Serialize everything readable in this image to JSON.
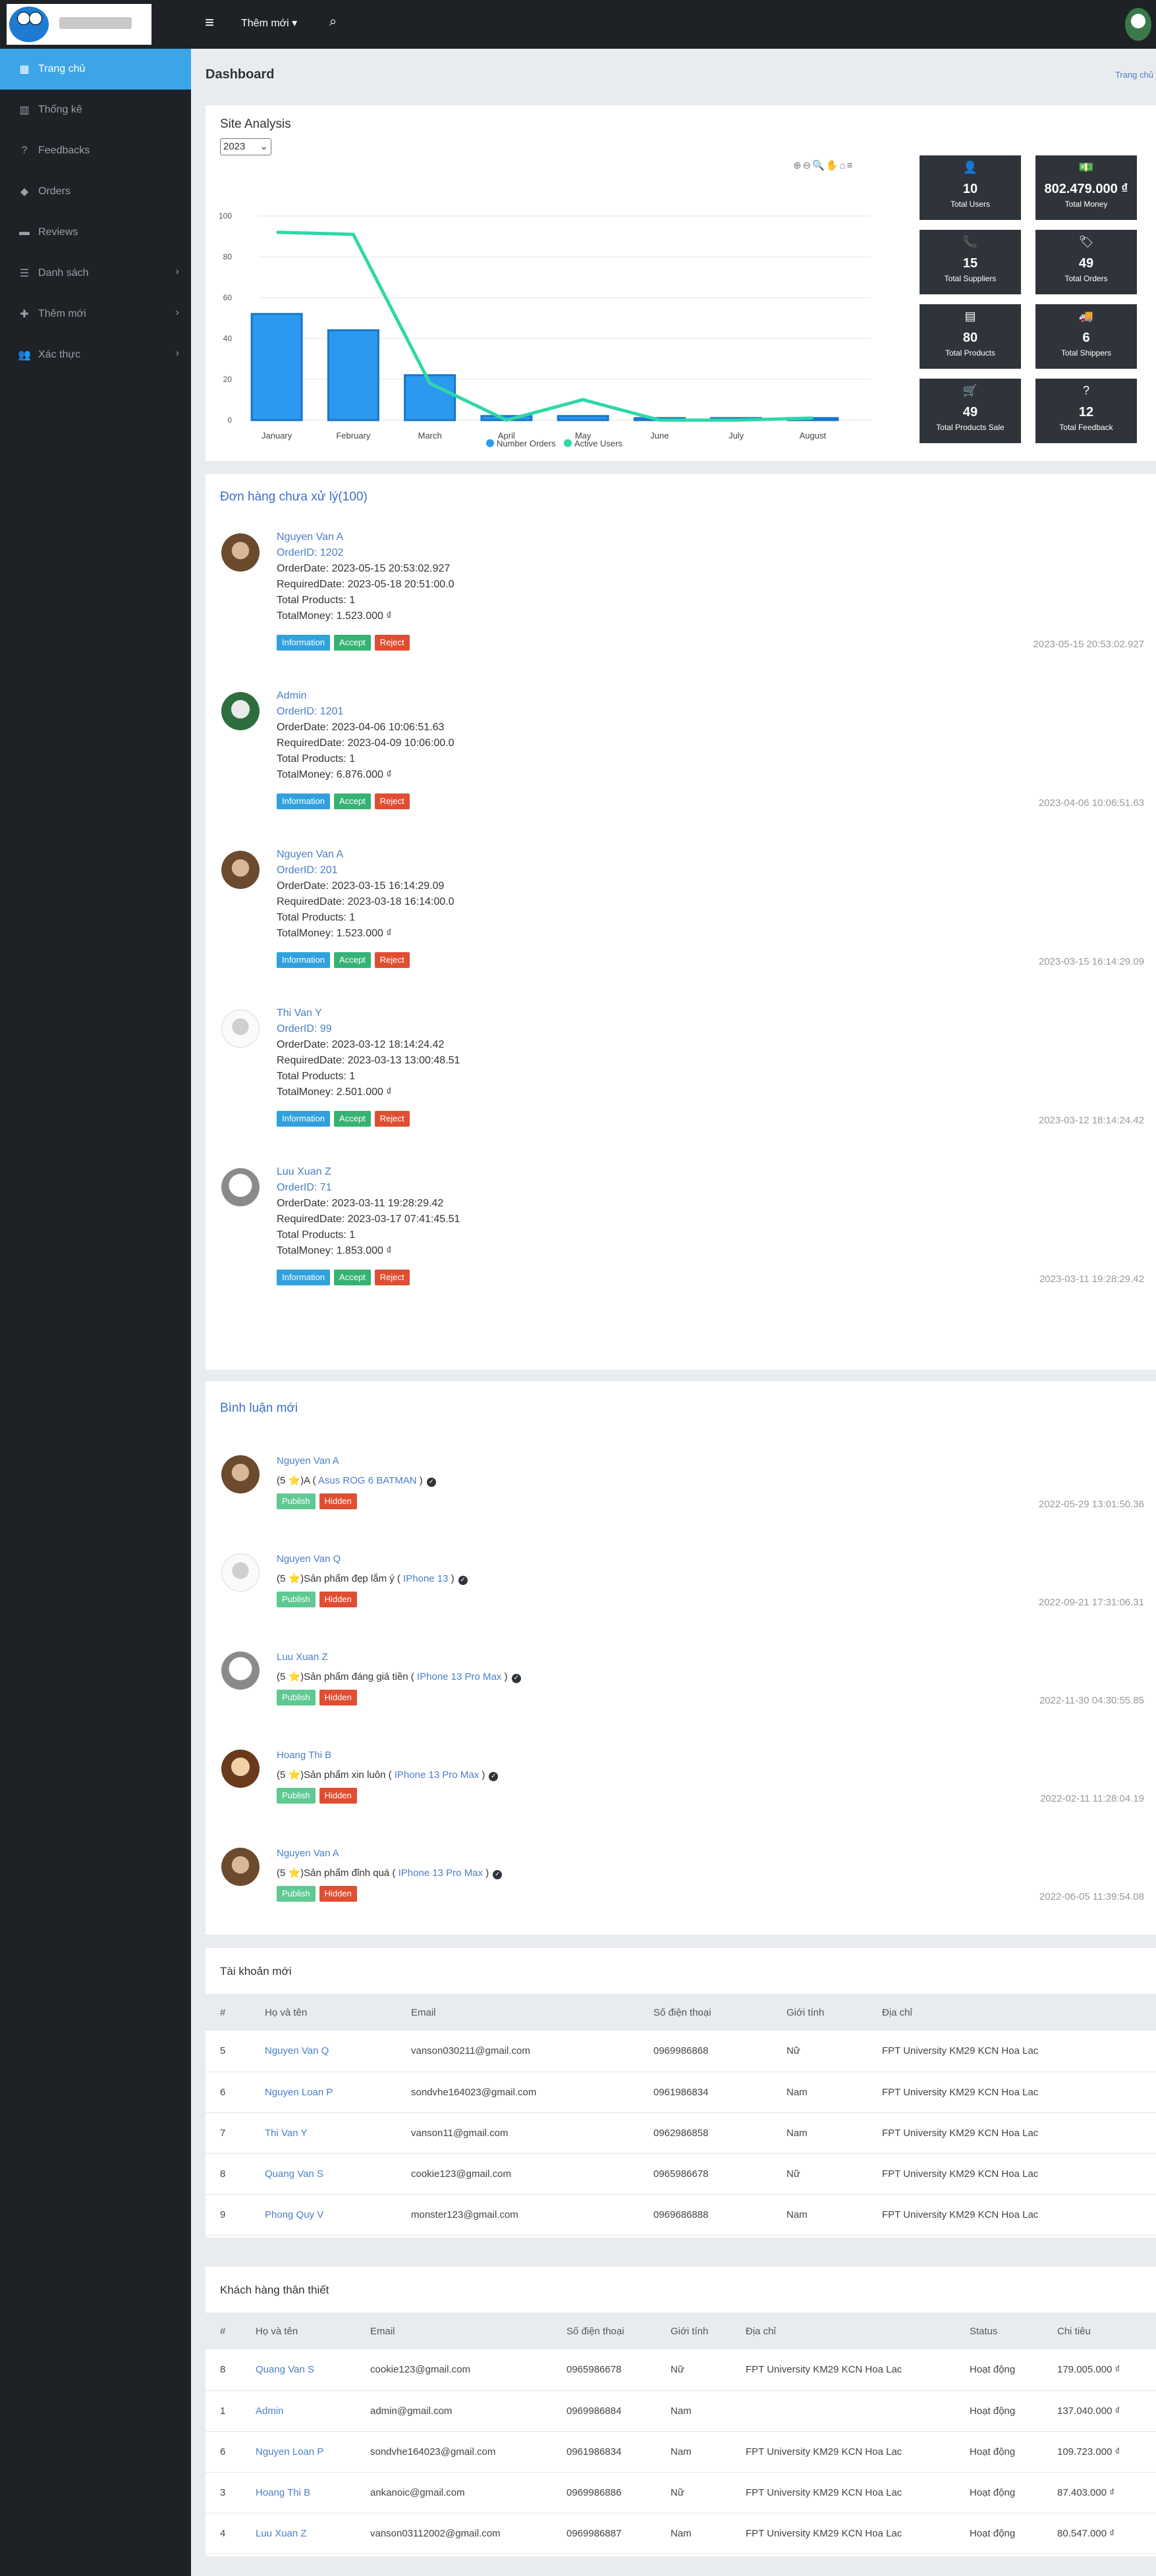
{
  "topbar": {
    "menu_label": "Thêm mới",
    "menu_caret": "▾"
  },
  "sidebar": {
    "items": [
      {
        "label": "Trang chủ",
        "icon": "dashboard-icon",
        "glyph": "▦"
      },
      {
        "label": "Thống kê",
        "icon": "chart-icon",
        "glyph": "▥"
      },
      {
        "label": "Feedbacks",
        "icon": "question-icon",
        "glyph": "?"
      },
      {
        "label": "Orders",
        "icon": "tag-icon",
        "glyph": "◆"
      },
      {
        "label": "Reviews",
        "icon": "comment-icon",
        "glyph": "▬"
      },
      {
        "label": "Danh sách",
        "icon": "list-icon",
        "glyph": "☰"
      },
      {
        "label": "Thêm mới",
        "icon": "add-icon",
        "glyph": "✚"
      },
      {
        "label": "Xác thực",
        "icon": "users-icon",
        "glyph": "👥"
      }
    ]
  },
  "page": {
    "title": "Dashboard",
    "breadcrumb": "Trang chủ"
  },
  "analysis": {
    "title": "Site Analysis",
    "year": "2023",
    "stats": [
      {
        "value": "10",
        "label": "Total Users",
        "icon": "user-icon",
        "glyph": "👤"
      },
      {
        "value": "802.479.000 ₫",
        "label": "Total Money",
        "icon": "money-icon",
        "glyph": "💵"
      },
      {
        "value": "15",
        "label": "Total Suppliers",
        "icon": "phone-icon",
        "glyph": "📞"
      },
      {
        "value": "49",
        "label": "Total Orders",
        "icon": "tags-icon",
        "glyph": "🏷"
      },
      {
        "value": "80",
        "label": "Total Products",
        "icon": "products-icon",
        "glyph": "▤"
      },
      {
        "value": "6",
        "label": "Total Shippers",
        "icon": "truck-icon",
        "glyph": "🚚"
      },
      {
        "value": "49",
        "label": "Total Products Sale",
        "icon": "cart-icon",
        "glyph": "🛒"
      },
      {
        "value": "12",
        "label": "Total Feedback",
        "icon": "question-icon",
        "glyph": "?"
      }
    ]
  },
  "chart_data": {
    "type": "bar",
    "categories": [
      "January",
      "February",
      "March",
      "April",
      "May",
      "June",
      "July",
      "August"
    ],
    "series": [
      {
        "name": "Number Orders",
        "type": "bar",
        "values": [
          52,
          44,
          22,
          2,
          2,
          1,
          1,
          1
        ],
        "color": "#2b99f0"
      },
      {
        "name": "Active Users",
        "type": "line",
        "values": [
          92,
          91,
          18,
          0,
          10,
          0,
          0,
          1
        ],
        "color": "#2fd7a6"
      }
    ],
    "ylim": [
      0,
      100
    ],
    "yticks": [
      "0",
      "20",
      "40",
      "60",
      "80",
      "100"
    ],
    "grid": true,
    "legend": "bottom"
  },
  "orders": {
    "title": "Đơn hàng chưa xử lý(100)",
    "items": [
      {
        "name": "Nguyen Van A",
        "id": "OrderID: 1202",
        "order_date": "OrderDate: 2023-05-15 20:53:02.927",
        "required": "RequiredDate: 2023-05-18 20:51:00.0",
        "products": "Total Products: 1",
        "money": "TotalMoney: 1.523.000 ₫",
        "ts": "2023-05-15 20:53:02.927",
        "avatar": "brown"
      },
      {
        "name": "Admin",
        "id": "OrderID: 1201",
        "order_date": "OrderDate: 2023-04-06 10:06:51.63",
        "required": "RequiredDate: 2023-04-09 10:06:00.0",
        "products": "Total Products: 1",
        "money": "TotalMoney: 6.876.000 ₫",
        "ts": "2023-04-06 10:06:51.63",
        "avatar": "green"
      },
      {
        "name": "Nguyen Van A",
        "id": "OrderID: 201",
        "order_date": "OrderDate: 2023-03-15 16:14:29.09",
        "required": "RequiredDate: 2023-03-18 16:14:00.0",
        "products": "Total Products: 1",
        "money": "TotalMoney: 1.523.000 ₫",
        "ts": "2023-03-15 16:14:29.09",
        "avatar": "brown"
      },
      {
        "name": "Thi Van Y",
        "id": "OrderID: 99",
        "order_date": "OrderDate: 2023-03-12 18:14:24.42",
        "required": "RequiredDate: 2023-03-13 13:00:48.51",
        "products": "Total Products: 1",
        "money": "TotalMoney: 2.501.000 ₫",
        "ts": "2023-03-12 18:14:24.42",
        "avatar": "white"
      },
      {
        "name": "Luu Xuan Z",
        "id": "OrderID: 71",
        "order_date": "OrderDate: 2023-03-11 19:28:29.42",
        "required": "RequiredDate: 2023-03-17 07:41:45.51",
        "products": "Total Products: 1",
        "money": "TotalMoney: 1.853.000 ₫",
        "ts": "2023-03-11 19:28:29.42",
        "avatar": "dog"
      }
    ],
    "buttons": {
      "info": "Information",
      "accept": "Accept",
      "reject": "Reject"
    }
  },
  "reviews": {
    "title": "Bình luận mới",
    "items": [
      {
        "name": "Nguyen Van A",
        "pre": "(5 ⭐)A (",
        "product": " Asus ROG 6 BATMAN ",
        "post": ")",
        "ts": "2022-05-29 13:01:50.36",
        "avatar": "brown"
      },
      {
        "name": "Nguyen Van Q",
        "pre": "(5 ⭐)Sản phẩm đẹp lắm ý (",
        "product": " IPhone 13 ",
        "post": ")",
        "ts": "2022-09-21 17:31:06.31",
        "avatar": "white"
      },
      {
        "name": "Luu Xuan Z",
        "pre": "(5 ⭐)Sản phẩm đáng giá tiền (",
        "product": " IPhone 13 Pro Max ",
        "post": ")",
        "ts": "2022-11-30 04:30:55.85",
        "avatar": "dog"
      },
      {
        "name": "Hoang Thi B",
        "pre": "(5 ⭐)Sản phẩm xin luôn (",
        "product": " IPhone 13 Pro Max ",
        "post": ")",
        "ts": "2022-02-11 11:28:04.19",
        "avatar": "girl"
      },
      {
        "name": "Nguyen Van A",
        "pre": "(5 ⭐)Sản phẩm đỉnh quá (",
        "product": " IPhone 13 Pro Max ",
        "post": ")",
        "ts": "2022-06-05 11:39:54.08",
        "avatar": "brown"
      }
    ],
    "buttons": {
      "publish": "Publish",
      "hidden": "Hidden"
    }
  },
  "accounts": {
    "title": "Tài khoản mới",
    "columns": [
      "#",
      "Họ và tên",
      "Email",
      "Số điện thoại",
      "Giới tính",
      "Địa chỉ"
    ],
    "rows": [
      [
        "5",
        "Nguyen Van Q",
        "vanson030211@gmail.com",
        "0969986868",
        "Nữ",
        "FPT University KM29 KCN Hoa Lac"
      ],
      [
        "6",
        "Nguyen Loan P",
        "sondvhe164023@gmail.com",
        "0961986834",
        "Nam",
        "FPT University KM29 KCN Hoa Lac"
      ],
      [
        "7",
        "Thi Van Y",
        "vanson11@gmail.com",
        "0962986858",
        "Nam",
        "FPT University KM29 KCN Hoa Lac"
      ],
      [
        "8",
        "Quang Van S",
        "cookie123@gmail.com",
        "0965986678",
        "Nữ",
        "FPT University KM29 KCN Hoa Lac"
      ],
      [
        "9",
        "Phong Quy V",
        "monster123@gmail.com",
        "0969686888",
        "Nam",
        "FPT University KM29 KCN Hoa Lac"
      ]
    ]
  },
  "customers": {
    "title": "Khách hàng thân thiết",
    "columns": [
      "#",
      "Họ và tên",
      "Email",
      "Số điện thoại",
      "Giới tính",
      "Địa chỉ",
      "Status",
      "Chi tiêu"
    ],
    "rows": [
      [
        "8",
        "Quang Van S",
        "cookie123@gmail.com",
        "0965986678",
        "Nữ",
        "FPT University KM29 KCN Hoa Lac",
        "Hoạt động",
        "179.005.000 ₫"
      ],
      [
        "1",
        "Admin",
        "admin@gmail.com",
        "0969986884",
        "Nam",
        "",
        "Hoạt động",
        "137.040.000 ₫"
      ],
      [
        "6",
        "Nguyen Loan P",
        "sondvhe164023@gmail.com",
        "0961986834",
        "Nam",
        "FPT University KM29 KCN Hoa Lac",
        "Hoạt động",
        "109.723.000 ₫"
      ],
      [
        "3",
        "Hoang Thi B",
        "ankanoic@gmail.com",
        "0969986886",
        "Nữ",
        "FPT University KM29 KCN Hoa Lac",
        "Hoạt động",
        "87.403.000 ₫"
      ],
      [
        "4",
        "Luu Xuan Z",
        "vanson03112002@gmail.com",
        "0969986887",
        "Nam",
        "FPT University KM29 KCN Hoa Lac",
        "Hoạt động",
        "80.547.000 ₫"
      ]
    ]
  }
}
